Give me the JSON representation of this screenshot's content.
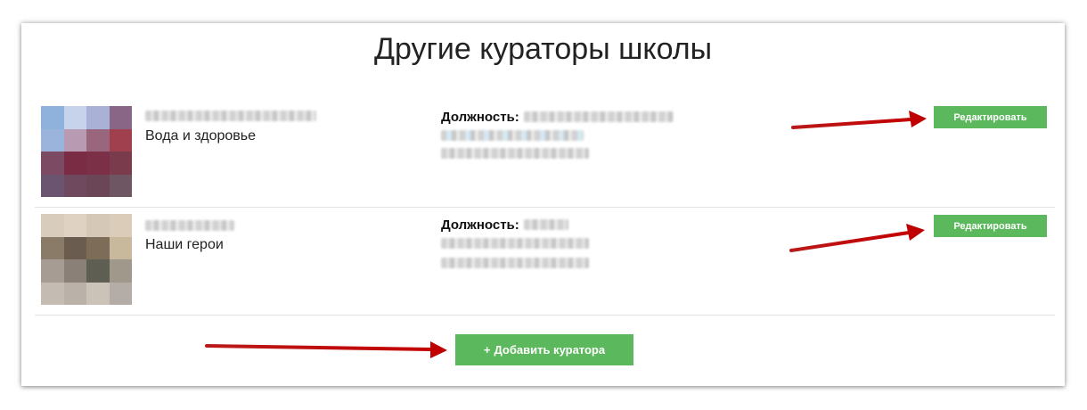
{
  "page": {
    "title": "Другие кураторы школы"
  },
  "curators": [
    {
      "subject": "Вода и здоровье",
      "position_label": "Должность:",
      "edit_label": "Редактировать"
    },
    {
      "subject": "Наши герои",
      "position_label": "Должность:",
      "edit_label": "Редактировать"
    }
  ],
  "add_button": {
    "icon": "+",
    "label": "Добавить куратора"
  },
  "colors": {
    "button_green": "#5cb85c",
    "annotation_arrow": "#b30000"
  },
  "annotations": {
    "arrow_icon": "red-arrow-icon"
  }
}
